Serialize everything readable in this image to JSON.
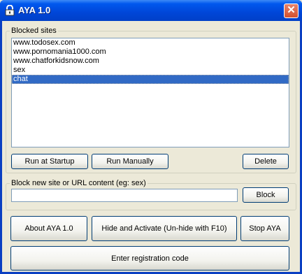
{
  "window": {
    "title": "AYA 1.0",
    "close_glyph": "✕"
  },
  "blocked_group": {
    "label": "Blocked sites",
    "items": [
      {
        "text": "www.todosex.com",
        "selected": false
      },
      {
        "text": "www.pornomania1000.com",
        "selected": false
      },
      {
        "text": "www.chatforkidsnow.com",
        "selected": false
      },
      {
        "text": "sex",
        "selected": false
      },
      {
        "text": "chat",
        "selected": true
      }
    ],
    "run_startup_label": "Run at Startup",
    "run_manually_label": "Run Manually",
    "delete_label": "Delete"
  },
  "block_group": {
    "label": "Block new site or URL content (eg: sex)",
    "input_value": "",
    "block_label": "Block"
  },
  "actions": {
    "about_label": "About AYA 1.0",
    "hide_label": "Hide and Activate (Un-hide with F10)",
    "stop_label": "Stop AYA",
    "register_label": "Enter registration code"
  },
  "colors": {
    "selection": "#316ac5",
    "titlebar": "#0058ee",
    "close": "#d4502e"
  },
  "icons": {
    "app": "lock-icon",
    "close": "close-icon"
  }
}
